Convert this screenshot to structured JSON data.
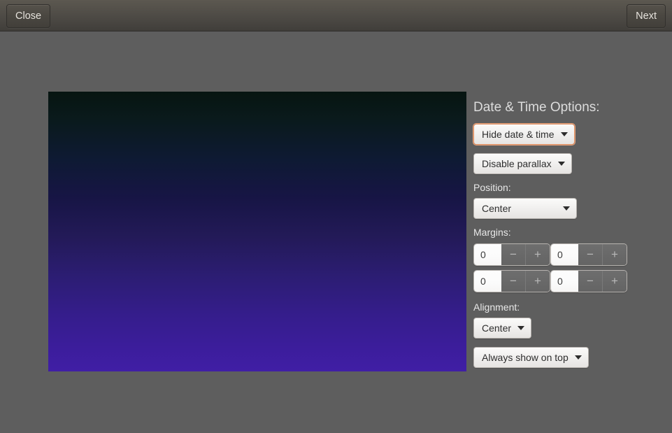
{
  "toolbar": {
    "close_label": "Close",
    "next_label": "Next"
  },
  "preview": {
    "name": "wallpaper-preview",
    "gradient_top": "#071511",
    "gradient_mid": "#231a58",
    "gradient_bottom": "#401ea5"
  },
  "options": {
    "section_title": "Date & Time Options:",
    "date_time_visibility": {
      "value": "Hide date & time",
      "focused": true
    },
    "parallax": {
      "value": "Disable parallax"
    },
    "position": {
      "label": "Position:",
      "value": "Center"
    },
    "margins": {
      "label": "Margins:",
      "fields": [
        {
          "name": "margin-left",
          "value": "0"
        },
        {
          "name": "margin-right",
          "value": "0"
        },
        {
          "name": "margin-top",
          "value": "0"
        },
        {
          "name": "margin-bottom",
          "value": "0"
        }
      ],
      "decrement_label": "−",
      "increment_label": "+"
    },
    "alignment": {
      "label": "Alignment:",
      "value": "Center"
    },
    "stacking": {
      "value": "Always show on top"
    }
  },
  "colors": {
    "window_background": "#5e5e5e",
    "toolbar_top": "#5c5850",
    "toolbar_bottom": "#403e3a",
    "focus_accent": "#d98d62"
  }
}
